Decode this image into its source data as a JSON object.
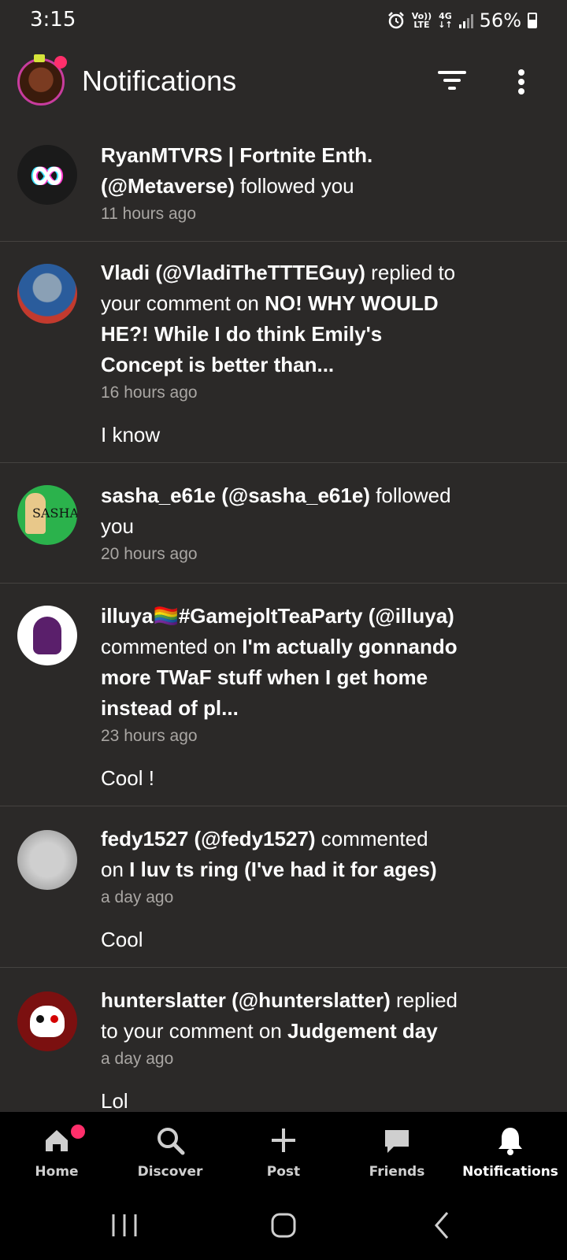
{
  "status_bar": {
    "time": "3:15",
    "volte": "Vo))",
    "lte": "LTE",
    "network": "4G",
    "battery": "56%"
  },
  "header": {
    "title": "Notifications"
  },
  "notifications": [
    {
      "actor": "RyanMTVRS | Fortnite Enth.",
      "handle": "(@Metaverse)",
      "action": "followed you",
      "time": "11 hours ago"
    },
    {
      "actor": "Vladi (@VladiTheTTTEGuy)",
      "action": "replied to your comment on",
      "target_line1": "NO! WHY WOULD",
      "target_line2": "HE?! While I do think Emily's",
      "target_line3": "Concept is better than...",
      "line1_prefix": "replied to",
      "line2_prefix": "your comment on",
      "time": "16 hours ago",
      "comment": "I know"
    },
    {
      "actor": "sasha_e61e (@sasha_e61e)",
      "action_line1": "followed",
      "action_line2": "you",
      "time": "20 hours ago",
      "avatar_text": "SASHA"
    },
    {
      "actor": "illuya🏳️‍🌈#GamejoltTeaParty (@illuya)",
      "action": "commented on",
      "target_line1": "I'm actually gonnando",
      "target_line2": "more TWaF stuff when I get home",
      "target_line3": "instead of pl...",
      "time": "23 hours ago",
      "comment": "Cool !"
    },
    {
      "actor": "fedy1527 (@fedy1527)",
      "action_line1": "commented",
      "action_line2": "on",
      "target": "I luv ts ring (I've had it for ages)",
      "time": "a day ago",
      "comment": "Cool"
    },
    {
      "actor": "hunterslatter (@hunterslatter)",
      "action_line1": "replied",
      "action_line2": "to your comment on",
      "target": "Judgement day",
      "time": "a day ago",
      "comment": "Lol"
    }
  ],
  "bottom_nav": {
    "items": [
      {
        "label": "Home",
        "icon": "home-icon"
      },
      {
        "label": "Discover",
        "icon": "search-icon"
      },
      {
        "label": "Post",
        "icon": "plus-icon"
      },
      {
        "label": "Friends",
        "icon": "chat-bubble-icon"
      },
      {
        "label": "Notifications",
        "icon": "bell-icon",
        "active": true
      }
    ]
  },
  "colors": {
    "background": "#2b2928",
    "accent_badge": "#ff2f6b",
    "muted_text": "#a9a6a3",
    "nav_bg": "#000000"
  }
}
